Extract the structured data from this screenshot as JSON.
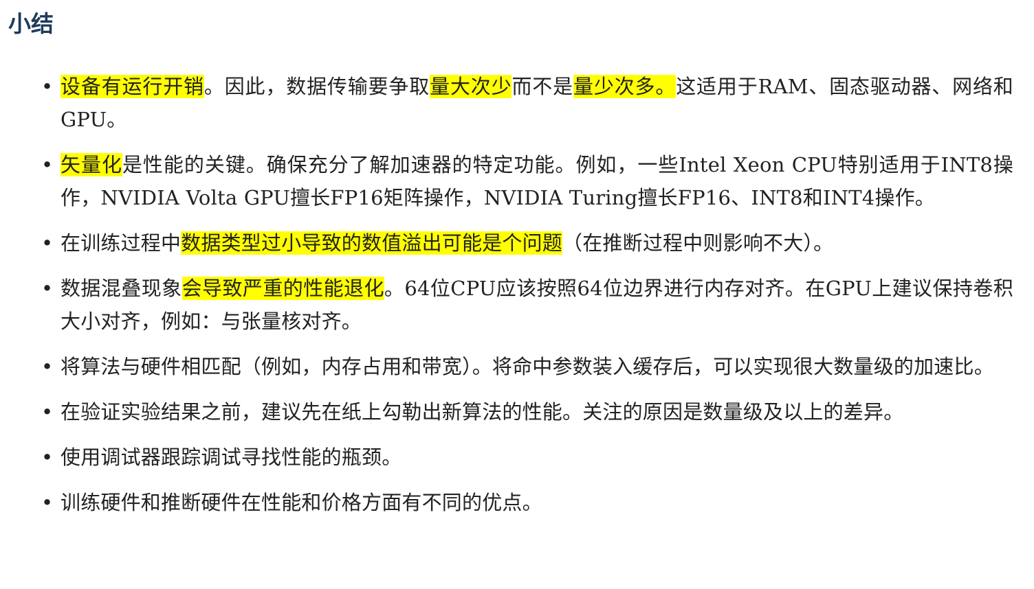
{
  "title": "小结",
  "highlight_color": "#ffff00",
  "title_color": "#1f3a5c",
  "items": [
    {
      "segments": [
        {
          "text": "设备有运行开销",
          "highlight": true
        },
        {
          "text": "。因此，数据传输要争取",
          "highlight": false
        },
        {
          "text": "量大次少",
          "highlight": true
        },
        {
          "text": "而不是",
          "highlight": false
        },
        {
          "text": "量少次多。",
          "highlight": true
        },
        {
          "text": "这适用于RAM、固态驱动器、网络和GPU。",
          "highlight": false
        }
      ]
    },
    {
      "segments": [
        {
          "text": "矢量化",
          "highlight": true
        },
        {
          "text": "是性能的关键。确保充分了解加速器的特定功能。例如，一些Intel Xeon CPU特别适用于INT8操作，NVIDIA Volta GPU擅长FP16矩阵操作，NVIDIA Turing擅长FP16、INT8和INT4操作。",
          "highlight": false
        }
      ]
    },
    {
      "segments": [
        {
          "text": "在训练过程中",
          "highlight": false
        },
        {
          "text": "数据类型过小导致的数值溢出可能是个问题",
          "highlight": true
        },
        {
          "text": "（在推断过程中则影响不大）。",
          "highlight": false
        }
      ]
    },
    {
      "segments": [
        {
          "text": "数据混叠现象",
          "highlight": false
        },
        {
          "text": "会导致严重的性能退化",
          "highlight": true
        },
        {
          "text": "。64位CPU应该按照64位边界进行内存对齐。在GPU上建议保持卷积大小对齐，例如：与张量核对齐。",
          "highlight": false
        }
      ]
    },
    {
      "segments": [
        {
          "text": "将算法与硬件相匹配（例如，内存占用和带宽）。将命中参数装入缓存后，可以实现很大数量级的加速比。",
          "highlight": false
        }
      ]
    },
    {
      "segments": [
        {
          "text": "在验证实验结果之前，建议先在纸上勾勒出新算法的性能。关注的原因是数量级及以上的差异。",
          "highlight": false
        }
      ]
    },
    {
      "segments": [
        {
          "text": "使用调试器跟踪调试寻找性能的瓶颈。",
          "highlight": false
        }
      ]
    },
    {
      "segments": [
        {
          "text": "训练硬件和推断硬件在性能和价格方面有不同的优点。",
          "highlight": false
        }
      ]
    }
  ]
}
